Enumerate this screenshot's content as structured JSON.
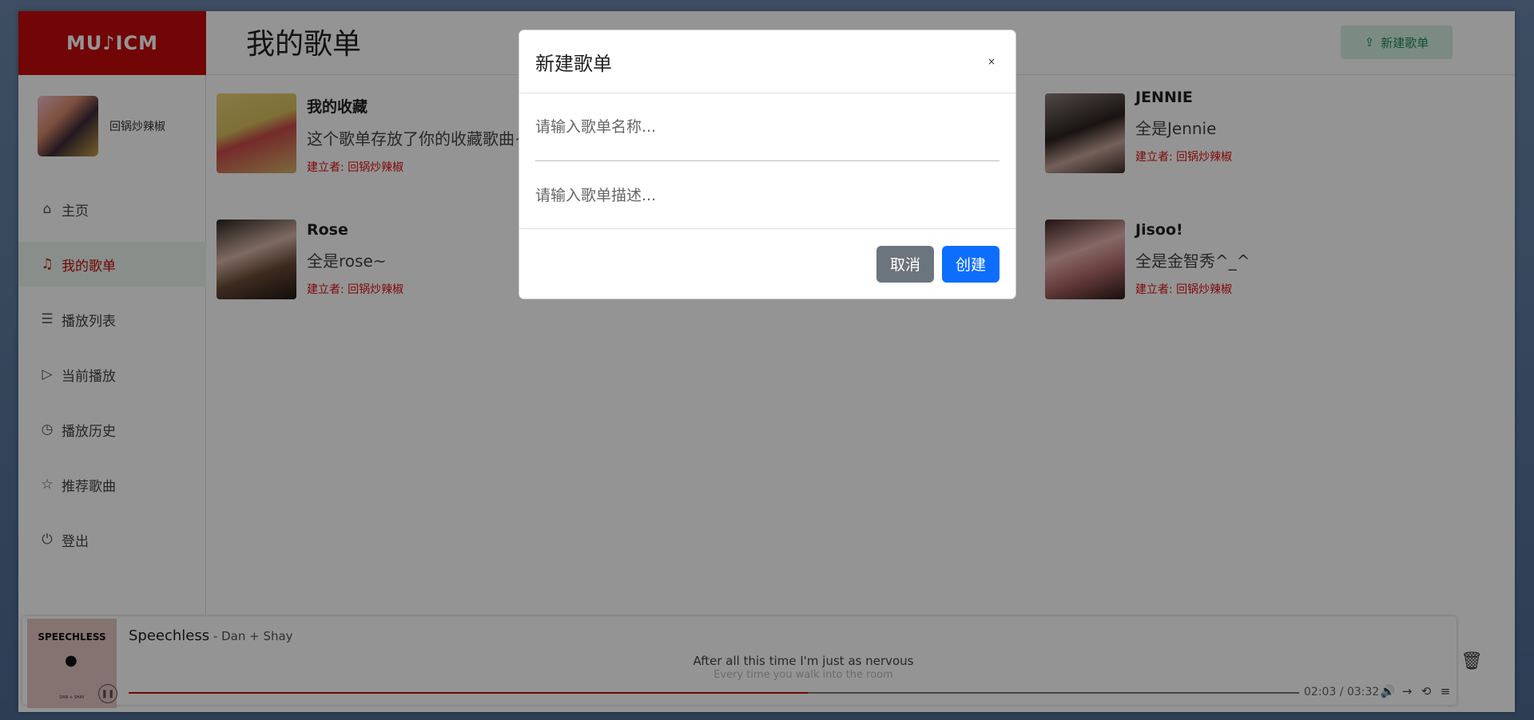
{
  "app": {
    "logo": "MU♪ICM",
    "title": "我的歌单",
    "new_playlist_button": "新建歌单"
  },
  "user": {
    "name": "回锅炒辣椒"
  },
  "nav": [
    {
      "label": "主页",
      "icon": "home-icon"
    },
    {
      "label": "我的歌单",
      "icon": "playlist-icon",
      "active": true
    },
    {
      "label": "播放列表",
      "icon": "list-icon"
    },
    {
      "label": "当前播放",
      "icon": "play-icon"
    },
    {
      "label": "播放历史",
      "icon": "clock-icon"
    },
    {
      "label": "推荐歌曲",
      "icon": "star-icon"
    },
    {
      "label": "登出",
      "icon": "logout-icon"
    }
  ],
  "playlists": [
    {
      "title": "我的收藏",
      "desc": "这个歌单存放了你的收藏歌曲~",
      "creator": "建立者: 回锅炒辣椒"
    },
    {
      "title": "JENNIE",
      "desc": "全是Jennie",
      "creator": "建立者: 回锅炒辣椒"
    },
    {
      "title": "Rose",
      "desc": "全是rose~",
      "creator": "建立者: 回锅炒辣椒"
    },
    {
      "title": "Jisoo!",
      "desc": "全是金智秀^_^",
      "creator": "建立者: 回锅炒辣椒"
    }
  ],
  "modal": {
    "title": "新建歌单",
    "close": "×",
    "name_placeholder": "请输入歌单名称...",
    "desc_placeholder": "请输入歌单描述...",
    "cancel": "取消",
    "create": "创建"
  },
  "player": {
    "album_text": "SPEECHLESS",
    "album_sub": "DAN + SHAY",
    "song": "Speechless",
    "artist": " - Dan + Shay",
    "lyric_current": "After all this time I'm just as nervous",
    "lyric_next": "Every time you walk into the room",
    "time": "02:03 / 03:32",
    "progress": 0.58
  },
  "colors": {
    "brand": "#c50a0a",
    "primary": "#0d6efd",
    "secondary": "#6c757d"
  }
}
